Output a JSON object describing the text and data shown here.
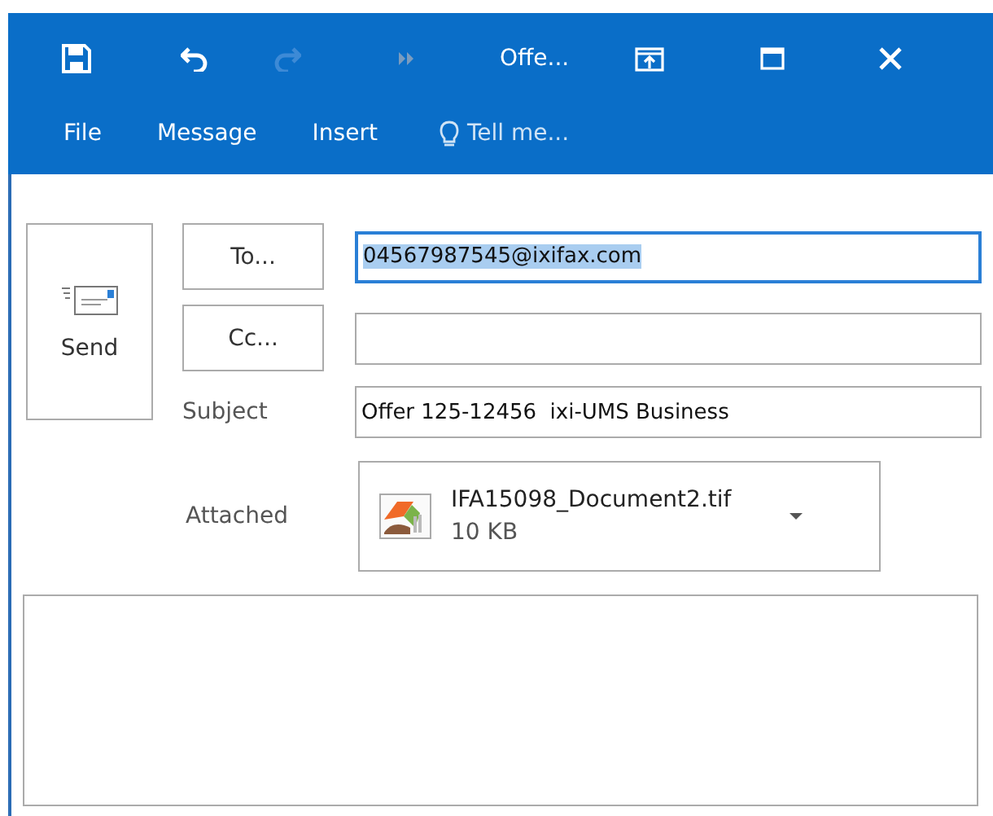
{
  "title_bar": {
    "title": "Offe...",
    "redo_disabled": true
  },
  "tabs": [
    {
      "label": "File",
      "selected": false
    },
    {
      "label": "Message",
      "selected": false
    },
    {
      "label": "Insert",
      "selected": false
    }
  ],
  "tell_me": {
    "placeholder": "Tell me..."
  },
  "send_button": {
    "label": "Send"
  },
  "fields": [
    {
      "kind": "button",
      "label": "To...",
      "value": "04567987545@ixifax.com",
      "focused": true
    },
    {
      "kind": "button",
      "label": "Cc...",
      "focused": false
    },
    {
      "kind": "label",
      "label": "Subject",
      "value": "Offer 125-12456  ixi-UMS Business",
      "focused": false
    }
  ],
  "attached": {
    "label": "Attached",
    "file_name": "IFA15098_Document2.tif",
    "size": "10 KB"
  }
}
